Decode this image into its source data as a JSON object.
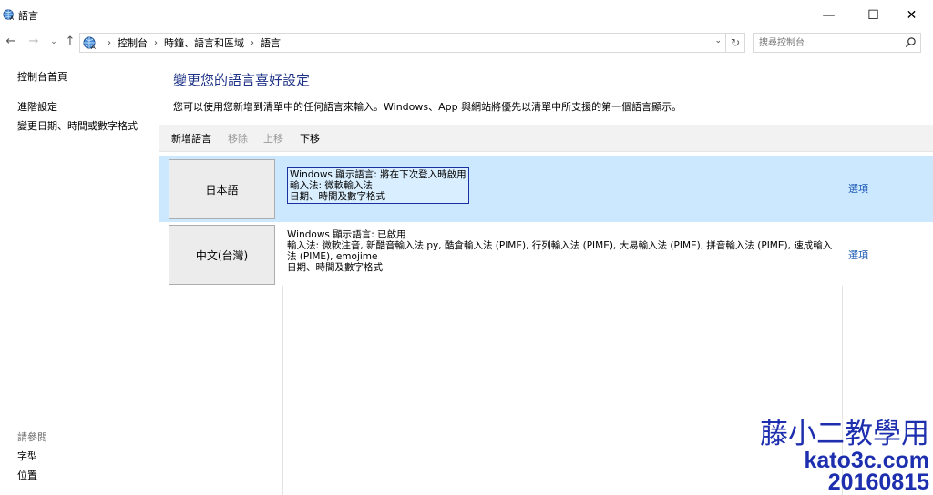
{
  "window": {
    "title": "語言",
    "minimize_glyph": "—",
    "maximize_glyph": "☐",
    "close_glyph": "✕"
  },
  "nav": {
    "back_glyph": "←",
    "forward_glyph": "→",
    "recent_glyph": "⌄",
    "up_glyph": "↑",
    "refresh_glyph": "↻",
    "dropdown_glyph": "⌄"
  },
  "breadcrumb": {
    "items": [
      "控制台",
      "時鐘、語言和區域",
      "語言"
    ],
    "separator": "›"
  },
  "search": {
    "placeholder": "搜尋控制台"
  },
  "sidebar": {
    "home": "控制台首頁",
    "advanced": "進階設定",
    "change_date": "變更日期、時間或數字格式",
    "see_also": "請參閱",
    "fonts": "字型",
    "location": "位置"
  },
  "main": {
    "title": "變更您的語言喜好設定",
    "description": "您可以使用您新增到清單中的任何語言來輸入。Windows、App 與網站將優先以清單中所支援的第一個語言顯示。"
  },
  "toolbar": {
    "add": "新增語言",
    "remove": "移除",
    "up": "上移",
    "down": "下移"
  },
  "languages": [
    {
      "name": "日本語",
      "display": "Windows 顯示語言: 將在下次登入時啟用",
      "input": "輸入法: 微軟輸入法",
      "format": "日期、時間及數字格式",
      "options": "選項"
    },
    {
      "name": "中文(台灣)",
      "display": "Windows 顯示語言: 已啟用",
      "input": "輸入法: 微軟注音, 新酷音輸入法.py, 酷倉輸入法 (PIME), 行列輸入法 (PIME), 大易輸入法 (PIME), 拼音輸入法 (PIME), 速成輸入法 (PIME), emojime",
      "format": "日期、時間及數字格式",
      "options": "選項"
    }
  ],
  "watermark": {
    "line1": "藤小二教學用",
    "line2": "kato3c.com",
    "line3": "20160815"
  },
  "colors": {
    "selected_row": "#cce8ff",
    "title_blue": "#1e3287",
    "link_blue": "#1e5bb5",
    "watermark_blue": "#1d2fae"
  }
}
